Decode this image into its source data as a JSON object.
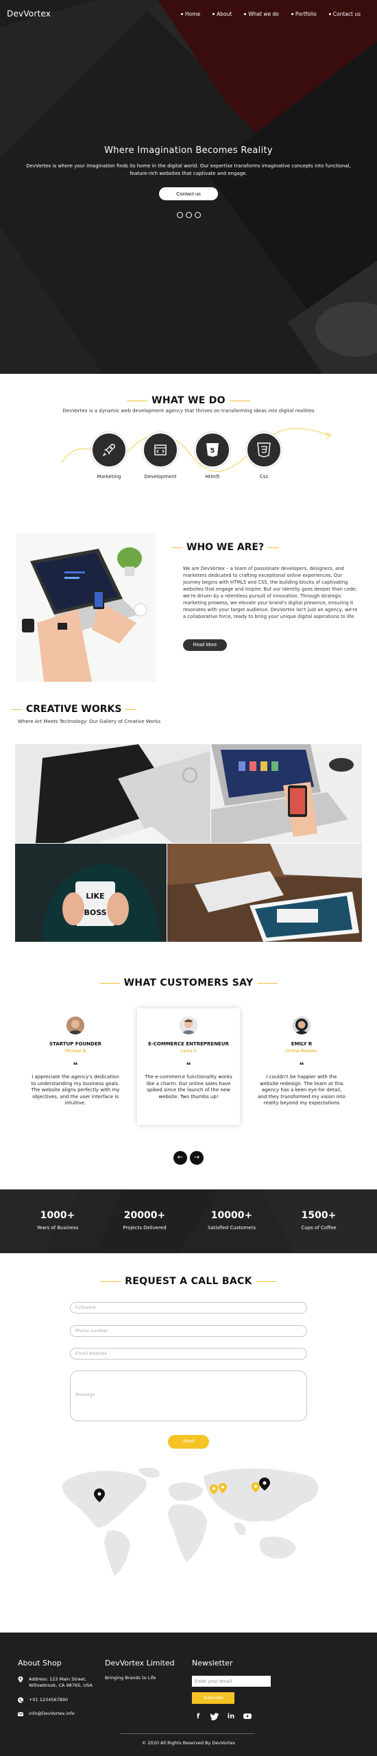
{
  "nav": {
    "brand": "DevVortex",
    "items": [
      "Home",
      "About",
      "What we do",
      "Portfolio",
      "Contact us"
    ]
  },
  "hero": {
    "title": "Where Imagination Becomes Reality",
    "text": "DevVortex is where your imagination finds its home in the digital world. Our expertise transforms imaginative concepts into functional, feature-rich websites that captivate and engage.",
    "button": "Contact us"
  },
  "what_we_do": {
    "title": "WHAT WE DO",
    "subtitle": "DevVortex is a dynamic web development agency that thrives on transforming ideas into digital realities",
    "services": [
      {
        "label": "Marketing",
        "icon": "rocket-icon"
      },
      {
        "label": "Development",
        "icon": "code-window-icon"
      },
      {
        "label": "Html5",
        "icon": "html5-icon"
      },
      {
        "label": "Css",
        "icon": "css3-icon"
      }
    ]
  },
  "who_we_are": {
    "title": "WHO WE ARE?",
    "text": "We are DevVortex – a team of passionate developers, designers, and marketers dedicated to crafting exceptional online experiences. Our journey begins with HTML5 and CSS, the building blocks of captivating websites that engage and inspire. But our identity goes deeper than code; we're driven by a relentless pursuit of innovation. Through strategic marketing prowess, we elevate your brand's digital presence, ensuring it resonates with your target audience. DevVortex isn't just an agency; we're a collaborative force, ready to bring your unique digital aspirations to life.",
    "button": "Read More"
  },
  "creative_works": {
    "title": "CREATIVE WORKS",
    "subtitle": "Where Art Meets Technology: Our Gallery of Creative Works"
  },
  "testimonials": {
    "title": "WHAT CUSTOMERS SAY",
    "items": [
      {
        "name": "STARTUP FOUNDER",
        "role": "Michael B",
        "quote": "I appreciate the agency's dedication to understanding my business goals. The website aligns perfectly with my objectives, and the user interface is intuitive."
      },
      {
        "name": "E-COMMERCE ENTREPRENEUR",
        "role": "Laura S",
        "quote": "The e-commerce functionality works like a charm. Our online sales have spiked since the launch of the new website. Two thumbs up!"
      },
      {
        "name": "EMILY R",
        "role": "Online Retailer",
        "quote": "I couldn't be happier with the website redesign. The team at this agency has a keen eye for detail, and they transformed my vision into reality beyond my expectations"
      }
    ],
    "prev": "←",
    "next": "→"
  },
  "stats": [
    {
      "num": "1000+",
      "label": "Years of Business"
    },
    {
      "num": "20000+",
      "label": "Projects Delivered"
    },
    {
      "num": "10000+",
      "label": "Satisfied Customers"
    },
    {
      "num": "1500+",
      "label": "Cups of Coffee"
    }
  ],
  "callback": {
    "title": "REQUEST A CALL BACK",
    "fullname": "Fullname",
    "phone": "Phone number",
    "email": "Email Address",
    "message": "Message",
    "button": "Send"
  },
  "footer": {
    "about_title": "About Shop",
    "address": "Address: 123 Main Street, Willowbrook, CA 98765, USA",
    "phone": "+01 1234567890",
    "email": "info@DevVortex.info",
    "brand_title": "DevVortex Limited",
    "brand_tagline": "Bringing Brands to Life",
    "newsletter_title": "Newsletter",
    "newsletter_placeholder": "Enter your email",
    "subscribe": "Subscribe",
    "copyright": "© 2020 All Rights Reserved By DevVortex"
  },
  "colors": {
    "accent": "#f5c325",
    "dark": "#232323"
  }
}
